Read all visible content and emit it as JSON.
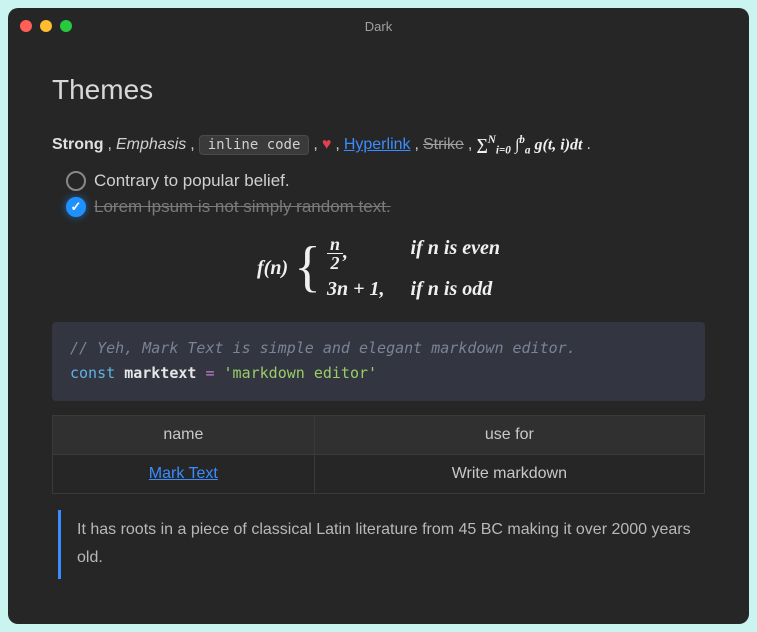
{
  "window": {
    "title": "Dark"
  },
  "heading": "Themes",
  "sample": {
    "strong": "Strong",
    "emphasis": "Emphasis",
    "inline_code": "inline code",
    "heart": "♥",
    "hyperlink": "Hyperlink",
    "strike": "Strike",
    "comma": ",",
    "period": "."
  },
  "math_inline": {
    "sum": "∑",
    "sum_sup": "N",
    "sum_sub": "i=0",
    "int": "∫",
    "int_sup": "b",
    "int_sub": "a",
    "body": "g(t, i)dt"
  },
  "tasks": [
    {
      "done": false,
      "text": "Contrary to popular belief."
    },
    {
      "done": true,
      "text": "Lorem Ipsum is not simply random text."
    }
  ],
  "math_block": {
    "lhs": "f(n)",
    "case1_val_num": "n",
    "case1_val_den": "2",
    "case1_val_suffix": ",",
    "case1_cond": "if n is even",
    "case2_val": "3n + 1,",
    "case2_cond": "if n is odd"
  },
  "code": {
    "comment": "// Yeh, Mark Text is simple and elegant markdown editor.",
    "keyword": "const",
    "var": "marktext",
    "op": "=",
    "string": "'markdown editor'"
  },
  "table": {
    "headers": [
      "name",
      "use for"
    ],
    "rows": [
      {
        "name": "Mark Text",
        "name_is_link": true,
        "use": "Write markdown"
      }
    ]
  },
  "quote": "It has roots in a piece of classical Latin literature from 45 BC making it over 2000 years old."
}
